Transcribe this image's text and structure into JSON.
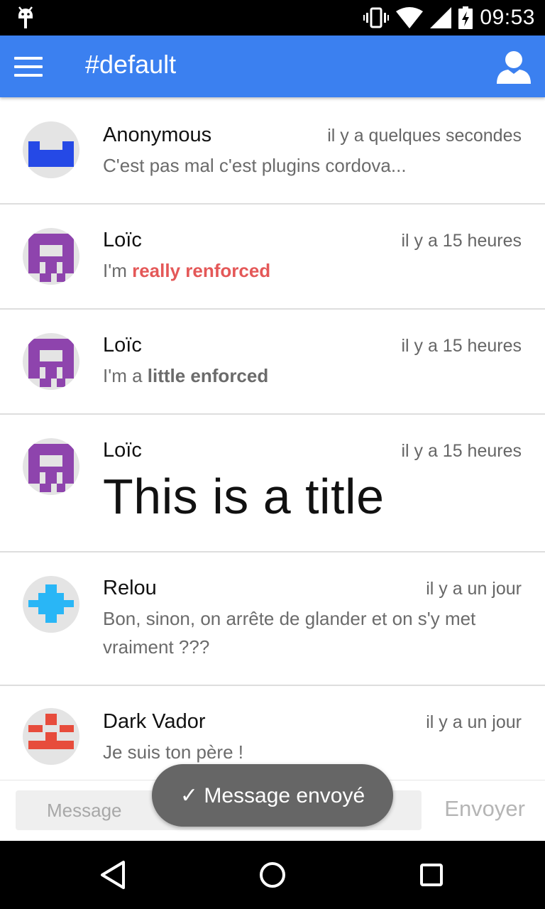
{
  "status_bar": {
    "time": "09:53",
    "icons": [
      "android-debug-icon",
      "vibrate-icon",
      "wifi-icon",
      "cell-signal-icon",
      "battery-charging-icon"
    ]
  },
  "app_bar": {
    "title": "#default",
    "menu_icon": "hamburger-menu-icon",
    "profile_icon": "user-profile-icon",
    "color": "#3b80f0"
  },
  "messages": [
    {
      "author": "Anonymous",
      "time": "il y a quelques secondes",
      "text": "C'est pas mal c'est plugins cordova...",
      "avatar_color": "#2549e6"
    },
    {
      "author": "Loïc",
      "time": "il y a 15 heures",
      "text_prefix": "I'm ",
      "text_highlight": "really renforced",
      "highlight_color": "#e45858",
      "avatar_color": "#8e44ad"
    },
    {
      "author": "Loïc",
      "time": "il y a 15 heures",
      "text_prefix": "I'm a ",
      "text_highlight": "little enforced",
      "avatar_color": "#8e44ad"
    },
    {
      "author": "Loïc",
      "time": "il y a 15 heures",
      "title": "This is a title",
      "avatar_color": "#8e44ad"
    },
    {
      "author": "Relou",
      "time": "il y a un jour",
      "text_line1": "Bon, sinon, on arrête de glander et on s'y met",
      "text_line2": "vraiment ???",
      "avatar_color": "#29b6f6"
    },
    {
      "author": "Dark Vador",
      "time": "il y a un jour",
      "text": "Je suis ton père !",
      "avatar_color": "#e74c3c"
    }
  ],
  "composer": {
    "placeholder": "Message",
    "value": "",
    "send_label": "Envoyer"
  },
  "toast": {
    "text": "✓ Message envoyé"
  },
  "nav_bar": {
    "icons": [
      "back-icon",
      "home-icon",
      "recents-icon"
    ]
  }
}
